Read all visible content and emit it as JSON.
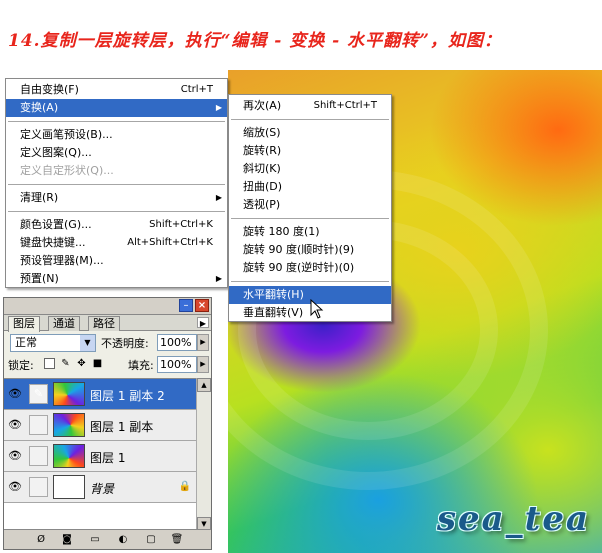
{
  "caption": "14.复制一层旋转层，执行“编辑 - 变换 - 水平翻转”，如图：",
  "watermark": "sea_tea",
  "edit_menu": {
    "items": [
      {
        "label": "自由变换(F)",
        "shortcut": "Ctrl+T"
      },
      {
        "label": "变换(A)",
        "submenu": true
      },
      {
        "label": "定义画笔预设(B)..."
      },
      {
        "label": "定义图案(Q)..."
      },
      {
        "label": "定义自定形状(Q)...",
        "disabled": true
      },
      {
        "label": "清理(R)",
        "submenu": true
      },
      {
        "label": "颜色设置(G)...",
        "shortcut": "Shift+Ctrl+K"
      },
      {
        "label": "键盘快捷键...",
        "shortcut": "Alt+Shift+Ctrl+K"
      },
      {
        "label": "预设管理器(M)..."
      },
      {
        "label": "预置(N)",
        "submenu": true
      }
    ]
  },
  "transform_menu": {
    "items": [
      {
        "label": "再次(A)",
        "shortcut": "Shift+Ctrl+T"
      },
      {
        "label": "缩放(S)"
      },
      {
        "label": "旋转(R)"
      },
      {
        "label": "斜切(K)"
      },
      {
        "label": "扭曲(D)"
      },
      {
        "label": "透视(P)"
      },
      {
        "label": "旋转 180 度(1)"
      },
      {
        "label": "旋转 90 度(顺时针)(9)"
      },
      {
        "label": "旋转 90 度(逆时针)(0)"
      },
      {
        "label": "水平翻转(H)"
      },
      {
        "label": "垂直翻转(V)"
      }
    ]
  },
  "layers_panel": {
    "tabs": [
      "图层",
      "通道",
      "路径"
    ],
    "blend_mode": "正常",
    "opacity_label": "不透明度:",
    "opacity_value": "100%",
    "lock_label": "锁定:",
    "fill_label": "填充:",
    "fill_value": "100%",
    "layers": [
      {
        "name": "图层 1 副本 2",
        "selected": true
      },
      {
        "name": "图层 1 副本"
      },
      {
        "name": "图层 1"
      },
      {
        "name": "背景",
        "locked": true
      }
    ]
  },
  "colors": {
    "caption": "#e8251c",
    "menu_highlight": "#316ac5",
    "watermark": "#1a5a8a"
  }
}
